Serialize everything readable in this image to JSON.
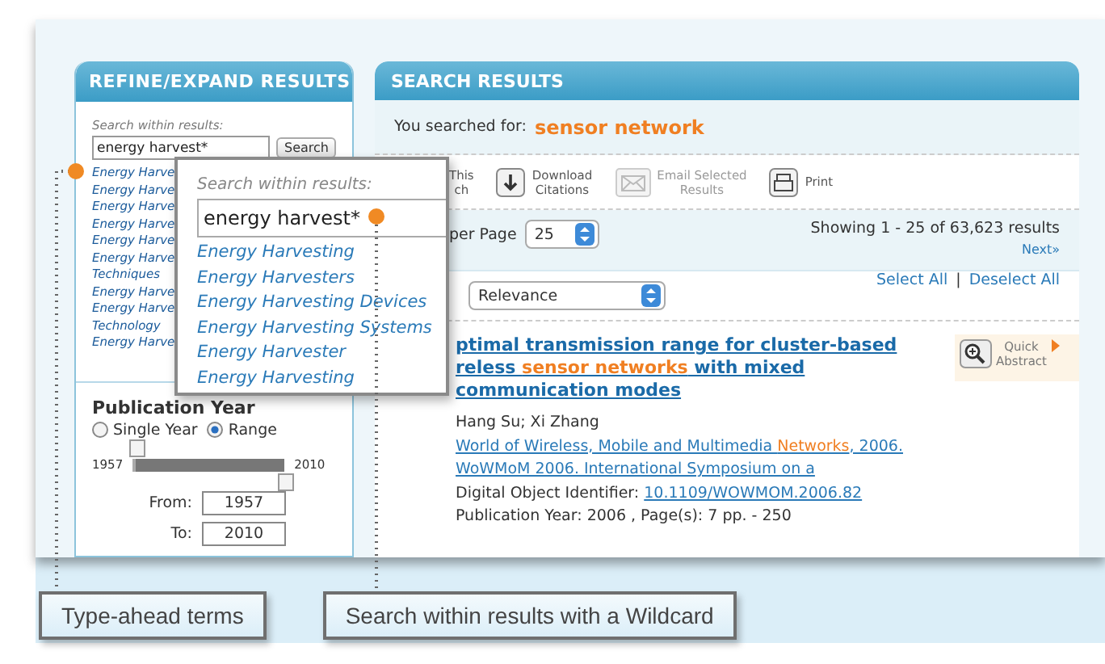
{
  "refine_panel": {
    "title": "REFINE/EXPAND RESULTS",
    "search_label": "Search within results:",
    "search_value": "energy harvest*",
    "search_button": "Search",
    "suggestions": [
      "Energy Harve",
      "Energy Harve",
      "Energy Harve",
      "Energy Harve",
      "Energy Harve",
      "Energy Harve",
      "Techniques",
      "Energy Harve",
      "Energy Harve",
      "Technology",
      "Energy Harve"
    ],
    "publication_year": {
      "title": "Publication Year",
      "modes": [
        {
          "label": "Single Year",
          "selected": false
        },
        {
          "label": "Range",
          "selected": true
        }
      ],
      "slider": {
        "min_label": "1957",
        "max_label": "2010",
        "thumbs": [
          {
            "level": 0
          },
          {
            "level": 1
          }
        ]
      },
      "from_label": "From:",
      "from_value": "1957",
      "to_label": "To:",
      "to_value": "2010"
    }
  },
  "typeahead_popup": {
    "label": "Search within results:",
    "value": "energy harvest*",
    "suggestions": [
      "Energy Harvesting",
      "Energy Harvesters",
      "Energy Harvesting Devices",
      "Energy Harvesting Systems",
      "Energy Harvester",
      "Energy Harvesting"
    ]
  },
  "results_panel": {
    "title": "SEARCH RESULTS",
    "searched_label": "You searched for:",
    "query": "sensor network",
    "toolbar": [
      {
        "kind": "partial",
        "lines": [
          "This",
          "ch"
        ],
        "disabled": false
      },
      {
        "kind": "download",
        "lines": [
          "Download",
          "Citations"
        ],
        "disabled": false
      },
      {
        "kind": "email",
        "lines": [
          "Email Selected",
          "Results"
        ],
        "disabled": true
      },
      {
        "kind": "print",
        "lines": [
          "Print"
        ],
        "disabled": false
      }
    ],
    "per_page_label": "per Page",
    "per_page": "25",
    "showing": "Showing 1 - 25 of 63,623 results",
    "next": "Next»",
    "sort": "Relevance",
    "select_all": "Select All",
    "separator": "|",
    "deselect_all": "Deselect All",
    "results": [
      {
        "title_lines": [
          [
            {
              "text": "ptimal transmission range for cluster-based",
              "highlight": false
            }
          ],
          [
            {
              "text": "reless ",
              "highlight": false
            },
            {
              "text": "sensor networks",
              "highlight": true
            },
            {
              "text": " with mixed",
              "highlight": false
            }
          ],
          [
            {
              "text": "communication modes",
              "highlight": false
            }
          ]
        ],
        "authors": "Hang Su; Xi Zhang",
        "venue_lines": [
          [
            {
              "text": "World of Wireless, Mobile and Multimedia ",
              "highlight": false
            },
            {
              "text": "Networks",
              "highlight": true
            },
            {
              "text": ", 2006.",
              "highlight": false
            }
          ],
          [
            {
              "text": "WoWMoM 2006. International Symposium on a",
              "highlight": false
            }
          ]
        ],
        "doi_label": "Digital Object Identifier:",
        "doi": "10.1109/WOWMOM.2006.82",
        "publication": "Publication Year: 2006 , Page(s): 7 pp. - 250",
        "quick_abstract": [
          "Quick",
          "Abstract"
        ]
      }
    ]
  },
  "callouts": [
    {
      "text": "Type-ahead terms"
    },
    {
      "text": "Search within results with a Wildcard"
    }
  ]
}
